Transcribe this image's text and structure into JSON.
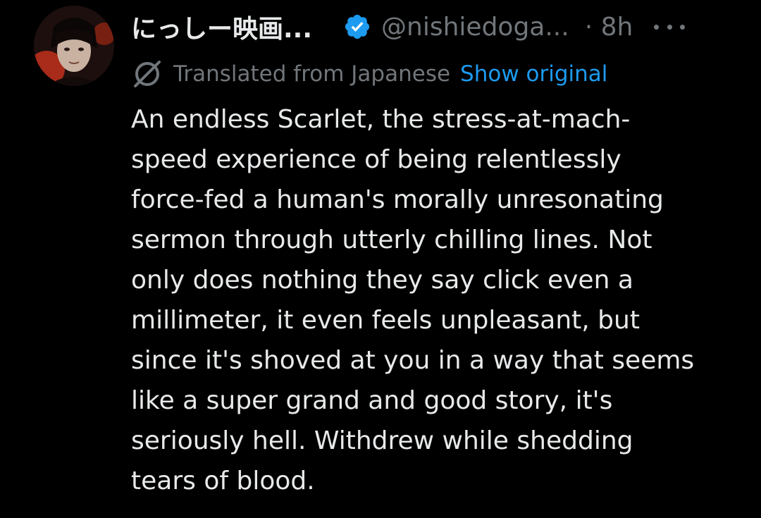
{
  "author": {
    "display_name": "にっしー映画...",
    "handle": "@nishiedoga...",
    "time": "· 8h"
  },
  "translation": {
    "label": "Translated from Japanese",
    "show_original": "Show original"
  },
  "tweet": {
    "lines": [
      "An endless Scarlet, the stress-at-mach-",
      "speed experience of being relentlessly",
      "force-fed a human's morally unresonating",
      "sermon through utterly chilling lines. Not",
      "only does nothing they say click even a",
      "millimeter, it even feels unpleasant, but",
      "since it's shoved at you in a way that seems",
      "like a super grand and good story, it's",
      "seriously hell. Withdrew while shedding",
      "tears of blood."
    ]
  },
  "colors": {
    "background": "#000000",
    "text": "#e7e9ea",
    "muted": "#71767b",
    "link": "#1d9bf0",
    "verified": "#1d9bf0"
  },
  "icons": {
    "verified": "verified-badge-icon",
    "translate": "translate-icon",
    "more": "more-icon"
  }
}
